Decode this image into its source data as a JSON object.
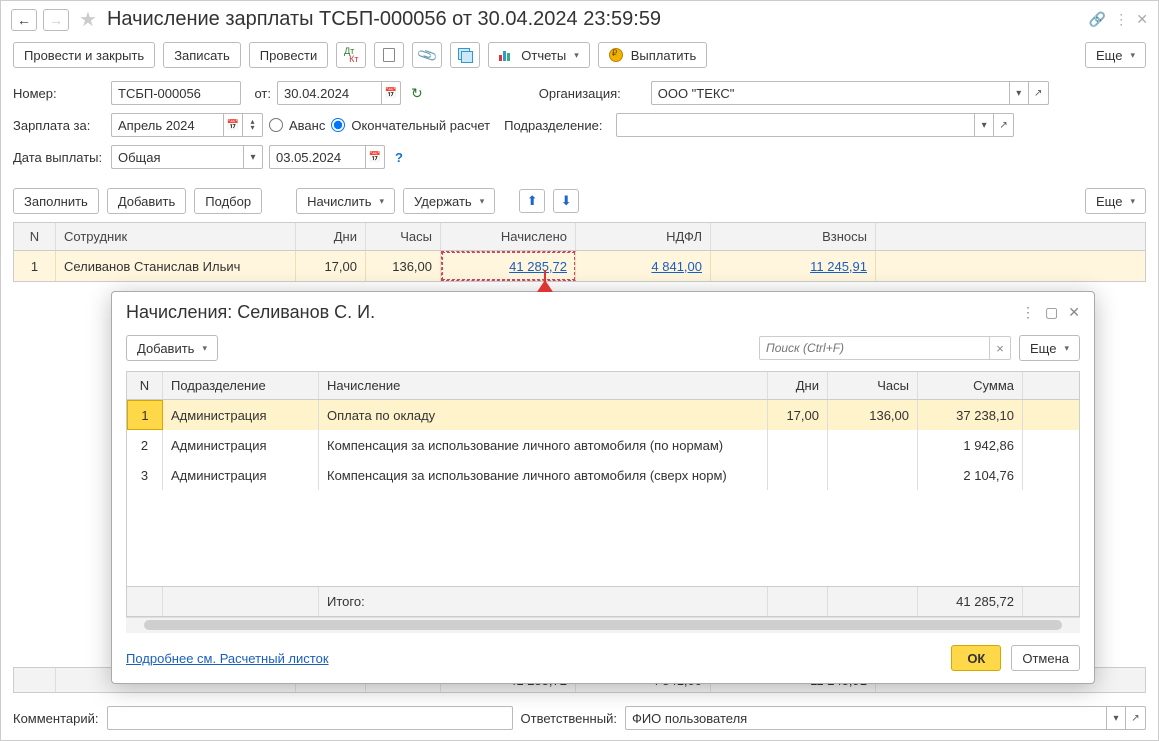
{
  "title": "Начисление зарплаты ТСБП-000056 от 30.04.2024 23:59:59",
  "toolbar": {
    "post_close": "Провести и закрыть",
    "write": "Записать",
    "post": "Провести",
    "reports": "Отчеты",
    "pay": "Выплатить",
    "more": "Еще"
  },
  "form": {
    "number_lbl": "Номер:",
    "number": "ТСБП-000056",
    "ot_lbl": "от:",
    "date": "30.04.2024",
    "org_lbl": "Организация:",
    "org": "ООО \"ТЕКС\"",
    "salary_for_lbl": "Зарплата за:",
    "salary_for": "Апрель 2024",
    "avans": "Аванс",
    "final": "Окончательный расчет",
    "dept_lbl": "Подразделение:",
    "dept": "",
    "paydate_lbl": "Дата выплаты:",
    "paydate_type": "Общая",
    "paydate": "03.05.2024"
  },
  "actions": {
    "fill": "Заполнить",
    "add": "Добавить",
    "pick": "Подбор",
    "accrue": "Начислить",
    "deduct": "Удержать",
    "more": "Еще"
  },
  "main_table": {
    "headers": {
      "n": "N",
      "emp": "Сотрудник",
      "dni": "Дни",
      "chy": "Часы",
      "nach": "Начислено",
      "ndfl": "НДФЛ",
      "vzn": "Взносы"
    },
    "row": {
      "n": "1",
      "emp": "Селиванов Станислав Ильич",
      "dni": "17,00",
      "chy": "136,00",
      "nach": "41 285,72",
      "ndfl": "4 841,00",
      "vzn": "11 245,91"
    },
    "totals": {
      "nach": "41 285,72",
      "ndfl": "4 841,00",
      "vzn": "11 245,91"
    }
  },
  "popup": {
    "title": "Начисления: Селиванов С. И.",
    "add": "Добавить",
    "more": "Еще",
    "search_ph": "Поиск (Ctrl+F)",
    "headers": {
      "n": "N",
      "dep": "Подразделение",
      "nach": "Начисление",
      "dni": "Дни",
      "chy": "Часы",
      "sum": "Сумма"
    },
    "rows": [
      {
        "n": "1",
        "dep": "Администрация",
        "nach": "Оплата по окладу",
        "dni": "17,00",
        "chy": "136,00",
        "sum": "37 238,10"
      },
      {
        "n": "2",
        "dep": "Администрация",
        "nach": "Компенсация за использование личного автомобиля (по нормам)",
        "dni": "",
        "chy": "",
        "sum": "1 942,86"
      },
      {
        "n": "3",
        "dep": "Администрация",
        "nach": "Компенсация за использование личного автомобиля (сверх норм)",
        "dni": "",
        "chy": "",
        "sum": "2 104,76"
      }
    ],
    "footer_lbl": "Итого:",
    "footer_sum": "41 285,72",
    "more_link": "Подробнее см. Расчетный листок",
    "ok": "ОК",
    "cancel": "Отмена"
  },
  "footer": {
    "comment_lbl": "Комментарий:",
    "comment": "",
    "responsible_lbl": "Ответственный:",
    "responsible": "ФИО пользователя"
  }
}
